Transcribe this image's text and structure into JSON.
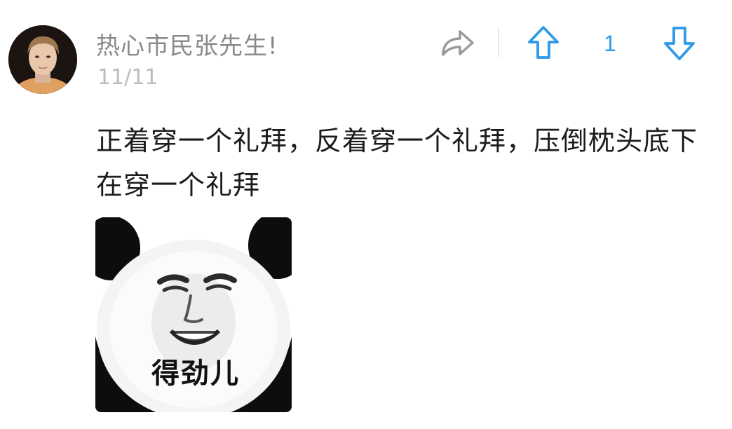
{
  "comment": {
    "author": {
      "name": "热心市民张先生!",
      "avatar_icon": "user-avatar-photo"
    },
    "timestamp": "11/11",
    "body": "正着穿一个礼拜，反着穿一个礼拜，压倒枕头底下在穿一个礼拜",
    "sticker": {
      "caption": "得劲儿",
      "icon": "panda-face-meme"
    }
  },
  "actions": {
    "share_icon": "share-arrow-icon",
    "upvote_icon": "up-arrow-icon",
    "downvote_icon": "down-arrow-icon",
    "vote_count": "1"
  },
  "colors": {
    "accent": "#2e9be6",
    "author": "#8a8a8a",
    "timestamp": "#bcbcbc",
    "body_text": "#1c1c1c",
    "icon_gray": "#9a9a9a"
  }
}
